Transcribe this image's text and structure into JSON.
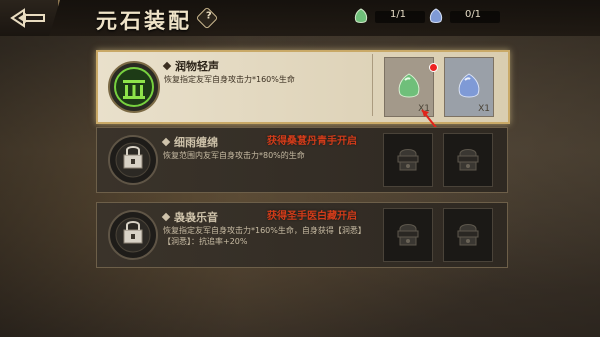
{
  "header": {
    "title": "元石装配",
    "help": "?",
    "green_count": "1/1",
    "blue_count": "0/1"
  },
  "cards": [
    {
      "name": "润物轻声",
      "desc": "恢复指定友军自身攻击力*160%生命",
      "state": "equipped",
      "slot1_qty": "X1",
      "slot2_qty": "X1"
    },
    {
      "name": "细雨缠绵",
      "desc": "恢复范围内友军自身攻击力*80%的生命",
      "lock_msg": "获得桑葚丹青手开启",
      "state": "locked"
    },
    {
      "name": "袅袅乐音",
      "desc": "恢复指定友军自身攻击力*160%生命，自身获得【洞悉】",
      "desc2": "【洞悉】：抗追率+20%",
      "lock_msg": "获得圣手医白藏开启",
      "state": "locked"
    }
  ],
  "colors": {
    "green_gem": "#6fbf7a",
    "blue_gem": "#7f9ad6",
    "lock_text": "#d23c1a"
  }
}
